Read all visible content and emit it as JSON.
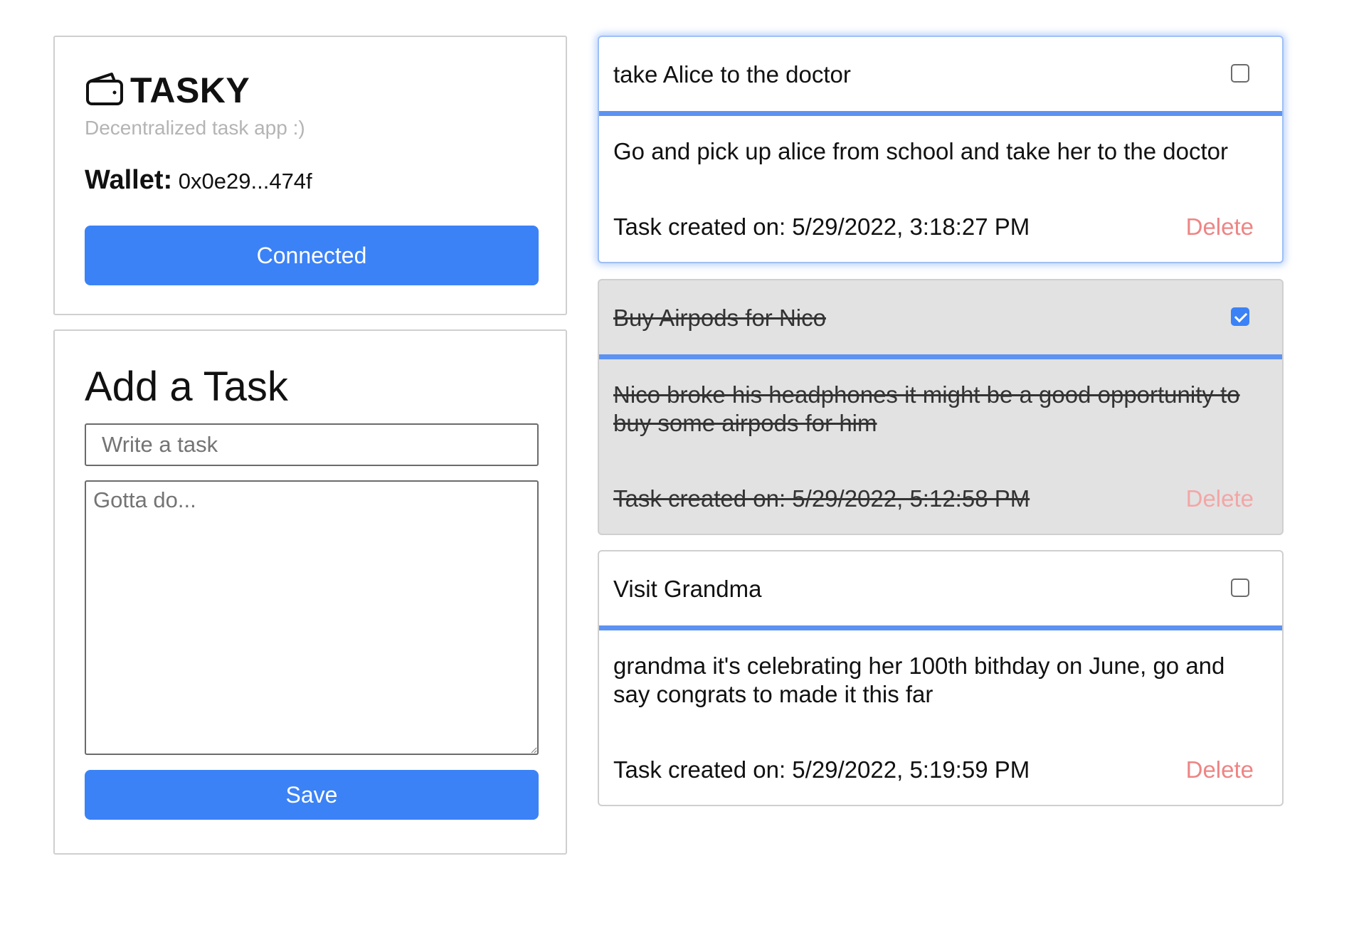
{
  "brand": {
    "title": "TASKY",
    "tagline": "Decentralized task app :)",
    "icon": "wallet-icon"
  },
  "wallet": {
    "label": "Wallet:",
    "address": "0x0e29...474f"
  },
  "connect_button": {
    "label": "Connected"
  },
  "add_task": {
    "heading": "Add a Task",
    "title_placeholder": "Write a task",
    "title_value": "",
    "desc_placeholder": "Gotta do...",
    "desc_value": "",
    "save_label": "Save"
  },
  "tasks": [
    {
      "title": "take Alice to the doctor",
      "description": "Go and pick up alice from school and take her to the doctor",
      "created": "Task created on: 5/29/2022, 3:18:27 PM",
      "completed": false,
      "delete_label": "Delete"
    },
    {
      "title": "Buy Airpods for Nico",
      "description": "Nico broke his headphones it might be a good opportunity to buy some airpods for him",
      "created": "Task created on: 5/29/2022, 5:12:58 PM",
      "completed": true,
      "delete_label": "Delete"
    },
    {
      "title": "Visit Grandma",
      "description": "grandma it's celebrating her 100th bithday on June, go and say congrats to made it this far",
      "created": "Task created on: 5/29/2022, 5:19:59 PM",
      "completed": false,
      "delete_label": "Delete"
    }
  ],
  "colors": {
    "accent": "#3b82f6",
    "card_divider": "#5c93f2",
    "delete": "#ee8585",
    "completed_bg": "#e2e2e2"
  }
}
